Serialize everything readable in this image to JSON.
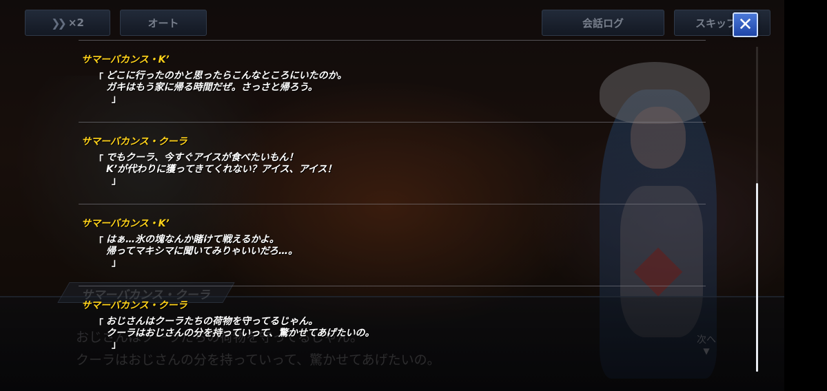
{
  "toolbar": {
    "speed_label": "×2",
    "auto_label": "オート",
    "log_label": "会話ログ",
    "skip_label": "スキップ",
    "close_icon": "close-icon"
  },
  "log_entries": [
    {
      "speaker": "サマーバカンス・K’",
      "open": "「",
      "lines": [
        "どこに行ったのかと思ったらこんなところにいたのか。",
        "ガキはもう家に帰る時間だぜ。さっさと帰ろう。"
      ],
      "close": "」"
    },
    {
      "speaker": "サマーバカンス・クーラ",
      "open": "「",
      "lines": [
        "でもクーラ、今すぐアイスが食べたいもん！",
        "K’が代わりに獲ってきてくれない？アイス、アイス！"
      ],
      "close": "」"
    },
    {
      "speaker": "サマーバカンス・K’",
      "open": "「",
      "lines": [
        "はぁ…氷の塊なんか賭けて戦えるかよ。",
        "帰ってマキシマに聞いてみりゃいいだろ…。"
      ],
      "close": "」"
    },
    {
      "speaker": "サマーバカンス・クーラ",
      "open": "「",
      "lines": [
        "おじさんはクーラたちの荷物を守ってるじゃん。",
        "クーラはおじさんの分を持っていって、驚かせてあげたいの。"
      ],
      "close": "」"
    }
  ],
  "dialog": {
    "name": "サマーバカンス・クーラ",
    "lines": [
      "おじさんはクーラたちの荷物を守ってるじゃん。",
      "クーラはおじさんの分を持っていって、驚かせてあげたいの。"
    ],
    "next_label": "次へ",
    "next_arrow": "▼"
  },
  "colors": {
    "speaker": "#ffd21a",
    "close_button": "#2f5fc4"
  }
}
